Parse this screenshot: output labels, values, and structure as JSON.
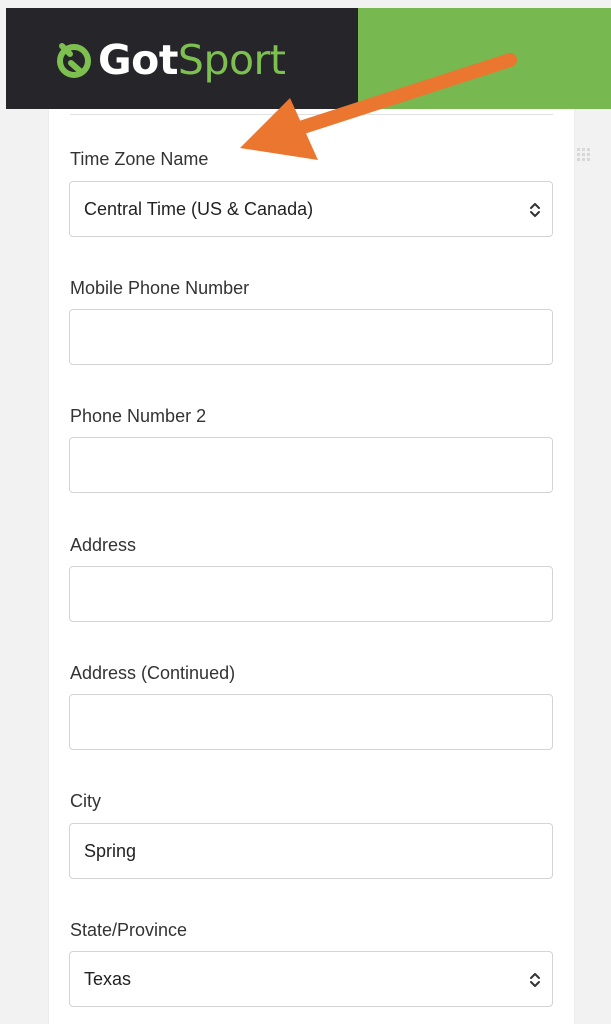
{
  "header": {
    "logo_got": "Got",
    "logo_sport": "Sport",
    "colors": {
      "dark": "#25252a",
      "green": "#78b851",
      "logo_green": "#7dc04f",
      "arrow": "#ea7630"
    }
  },
  "form": {
    "time_zone": {
      "label": "Time Zone Name",
      "value": "Central Time (US & Canada)"
    },
    "mobile_phone": {
      "label": "Mobile Phone Number",
      "value": ""
    },
    "phone_2": {
      "label": "Phone Number 2",
      "value": ""
    },
    "address": {
      "label": "Address",
      "value": ""
    },
    "address_continued": {
      "label": "Address (Continued)",
      "value": ""
    },
    "city": {
      "label": "City",
      "value": "Spring"
    },
    "state": {
      "label": "State/Province",
      "value": "Texas"
    }
  },
  "icons": {
    "logo": "gotsport-logo-icon",
    "arrow": "annotation-arrow-icon",
    "grid": "grid-icon",
    "caret": "select-caret-icon"
  }
}
